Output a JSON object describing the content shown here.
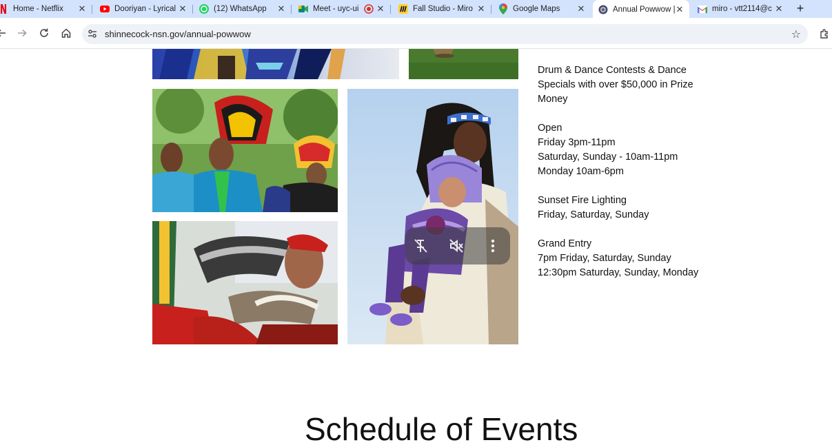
{
  "browser": {
    "tabs": [
      {
        "label": "Home - Netflix",
        "icon": "netflix-icon",
        "color": "#e50914"
      },
      {
        "label": "Dooriyan - Lyrical",
        "icon": "youtube-icon",
        "color": "#ff0000"
      },
      {
        "label": "(12) WhatsApp",
        "icon": "whatsapp-icon",
        "color": "#25d366"
      },
      {
        "label": "Meet - uyc-ui",
        "icon": "google-meet-icon",
        "color": "#00897b"
      },
      {
        "label": "Fall Studio - Miro",
        "icon": "miro-icon",
        "color": "#ffd02f"
      },
      {
        "label": "Google Maps",
        "icon": "google-maps-icon",
        "color": "#34a853"
      },
      {
        "label": "Annual Powwow |",
        "icon": "shinnecock-seal-icon",
        "color": "#3b4a8a",
        "active": true
      },
      {
        "label": "miro - vtt2114@c",
        "icon": "gmail-icon",
        "color": "#ea4335"
      }
    ],
    "new_tab_label": "+",
    "address": "shinnecock-nsn.gov/annual-powwow"
  },
  "info": {
    "contests": [
      "Drum & Dance Contests & Dance",
      "Specials with over $50,000 in Prize",
      "Money"
    ],
    "open": [
      "Open",
      "Friday 3pm-11pm",
      "Saturday, Sunday - 10am-11pm",
      "Monday 10am-6pm"
    ],
    "sunset": [
      "Sunset Fire Lighting",
      "Friday, Saturday, Sunday"
    ],
    "grand_entry": [
      "Grand Entry",
      "7pm Friday, Saturday, Sunday",
      "12:30pm Saturday, Sunday, Monday"
    ]
  },
  "schedule_heading": "Schedule of Events",
  "colors": {
    "tabstrip": "#d3e3fd",
    "omnibox": "#eef1f6"
  }
}
